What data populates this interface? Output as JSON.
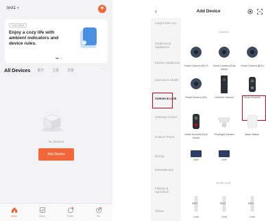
{
  "left": {
    "home_name": "test1",
    "banner": {
      "tag": "Cozy Home",
      "text": "Enjoy a cozy life with ambient indicators and device rules."
    },
    "tabs": [
      "All Devices",
      "客厅",
      "主卧",
      "次卧"
    ],
    "more_label": "···",
    "empty_text": "No devices",
    "add_button": "Add Device",
    "nav": [
      {
        "label": "Home",
        "icon": "home-icon"
      },
      {
        "label": "Scene",
        "icon": "scene-icon"
      },
      {
        "label": "Smart",
        "icon": "smart-icon"
      },
      {
        "label": "Me",
        "icon": "me-icon"
      }
    ],
    "accent_color": "#f0673a"
  },
  "right": {
    "title": "Add Device",
    "back": "‹",
    "categories": [
      "Large Home Ap...",
      "Small Home Appliances",
      "Kitchen Appliances",
      "Exercise & Health",
      "Camera & Lock",
      "Gateway Control",
      "Outdoor Travel",
      "Energy",
      "Entertainment",
      "Industry & Agriculture",
      "Others"
    ],
    "sections": {
      "camera": "Camera",
      "smart_lock": "Smart Lock"
    },
    "devices": [
      "Smart Camera (Wi-Fi)",
      "Smart Camera (Dual Band)",
      "Smart Camera (BLE)",
      "Smart Camera (4G)",
      "Doorbell Camera",
      "Smart Doorbell",
      "Smart Doorbell (Dual Band)",
      "Floodlight Camera",
      "Base Station",
      "NVR",
      "DVR",
      "Lock",
      "Lock",
      "Lock"
    ],
    "highlight_color": "#d0021b"
  }
}
